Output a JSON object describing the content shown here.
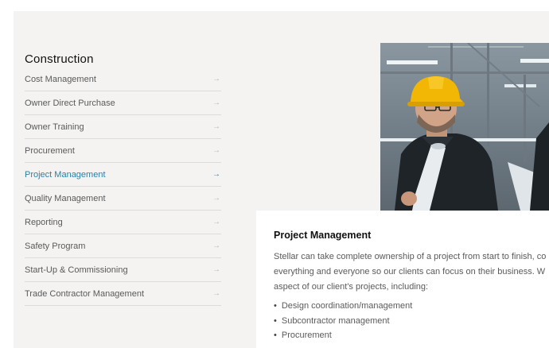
{
  "section": {
    "title": "Construction"
  },
  "menu": {
    "items": [
      {
        "label": "Cost Management",
        "arrow": "→",
        "active": false
      },
      {
        "label": "Owner Direct Purchase",
        "arrow": "→",
        "active": false
      },
      {
        "label": "Owner Training",
        "arrow": "→",
        "active": false
      },
      {
        "label": "Procurement",
        "arrow": "→",
        "active": false
      },
      {
        "label": "Project Management",
        "arrow": "→",
        "active": true
      },
      {
        "label": "Quality Management",
        "arrow": "→",
        "active": false
      },
      {
        "label": "Reporting",
        "arrow": "→",
        "active": false
      },
      {
        "label": "Safety Program",
        "arrow": "→",
        "active": false
      },
      {
        "label": "Start-Up & Commissioning",
        "arrow": "→",
        "active": false
      },
      {
        "label": "Trade Contractor Management",
        "arrow": "→",
        "active": false
      }
    ]
  },
  "detail": {
    "title": "Project Management",
    "lines": [
      "Stellar can take complete ownership of a project from start to finish, co",
      "everything and everyone so our clients can focus on their business. W",
      "aspect of our client's projects, including:"
    ],
    "bullets": [
      "Design coordination/management",
      "Subcontractor management",
      "Procurement"
    ]
  },
  "colors": {
    "accent": "#2d7fa3",
    "panel": "#f4f3f1",
    "helmet": "#f2b705"
  }
}
